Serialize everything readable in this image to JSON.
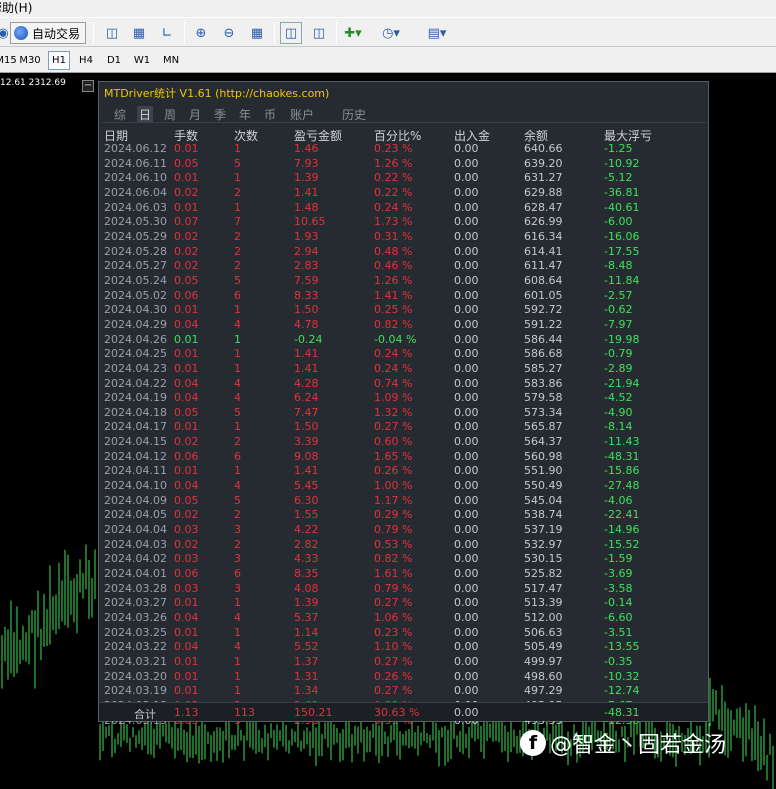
{
  "menubar": {
    "help_label": "帮助(H)"
  },
  "toolbar": {
    "autotrade_label": "自动交易"
  },
  "timeframes": [
    "M15",
    "M30",
    "H1",
    "H4",
    "D1",
    "W1",
    "MN"
  ],
  "timeframe_active": "H1",
  "chart": {
    "price_label": "12.61 2312.69"
  },
  "panel": {
    "title": "MTDriver统计 V1.61  (http://chaokes.com)",
    "tabs": [
      "综",
      "日",
      "周",
      "月",
      "季",
      "年",
      "币",
      "账户",
      "历史"
    ],
    "active_tab": "日",
    "headers": [
      "日期",
      "手数",
      "次数",
      "盈亏金额",
      "百分比%",
      "出入金",
      "余额",
      "最大浮亏"
    ],
    "rows": [
      [
        "2024.06.12",
        "0.01",
        "1",
        "1.46",
        "0.23 %",
        "0.00",
        "640.66",
        "-1.25"
      ],
      [
        "2024.06.11",
        "0.05",
        "5",
        "7.93",
        "1.26 %",
        "0.00",
        "639.20",
        "-10.92"
      ],
      [
        "2024.06.10",
        "0.01",
        "1",
        "1.39",
        "0.22 %",
        "0.00",
        "631.27",
        "-5.12"
      ],
      [
        "2024.06.04",
        "0.02",
        "2",
        "1.41",
        "0.22 %",
        "0.00",
        "629.88",
        "-36.81"
      ],
      [
        "2024.06.03",
        "0.01",
        "1",
        "1.48",
        "0.24 %",
        "0.00",
        "628.47",
        "-40.61"
      ],
      [
        "2024.05.30",
        "0.07",
        "7",
        "10.65",
        "1.73 %",
        "0.00",
        "626.99",
        "-6.00"
      ],
      [
        "2024.05.29",
        "0.02",
        "2",
        "1.93",
        "0.31 %",
        "0.00",
        "616.34",
        "-16.06"
      ],
      [
        "2024.05.28",
        "0.02",
        "2",
        "2.94",
        "0.48 %",
        "0.00",
        "614.41",
        "-17.55"
      ],
      [
        "2024.05.27",
        "0.02",
        "2",
        "2.83",
        "0.46 %",
        "0.00",
        "611.47",
        "-8.48"
      ],
      [
        "2024.05.24",
        "0.05",
        "5",
        "7.59",
        "1.26 %",
        "0.00",
        "608.64",
        "-11.84"
      ],
      [
        "2024.05.02",
        "0.06",
        "6",
        "8.33",
        "1.41 %",
        "0.00",
        "601.05",
        "-2.57"
      ],
      [
        "2024.04.30",
        "0.01",
        "1",
        "1.50",
        "0.25 %",
        "0.00",
        "592.72",
        "-0.62"
      ],
      [
        "2024.04.29",
        "0.04",
        "4",
        "4.78",
        "0.82 %",
        "0.00",
        "591.22",
        "-7.97"
      ],
      [
        "2024.04.26",
        "0.01",
        "1",
        "-0.24",
        "-0.04 %",
        "0.00",
        "586.44",
        "-19.98"
      ],
      [
        "2024.04.25",
        "0.01",
        "1",
        "1.41",
        "0.24 %",
        "0.00",
        "586.68",
        "-0.79"
      ],
      [
        "2024.04.23",
        "0.01",
        "1",
        "1.41",
        "0.24 %",
        "0.00",
        "585.27",
        "-2.89"
      ],
      [
        "2024.04.22",
        "0.04",
        "4",
        "4.28",
        "0.74 %",
        "0.00",
        "583.86",
        "-21.94"
      ],
      [
        "2024.04.19",
        "0.04",
        "4",
        "6.24",
        "1.09 %",
        "0.00",
        "579.58",
        "-4.52"
      ],
      [
        "2024.04.18",
        "0.05",
        "5",
        "7.47",
        "1.32 %",
        "0.00",
        "573.34",
        "-4.90"
      ],
      [
        "2024.04.17",
        "0.01",
        "1",
        "1.50",
        "0.27 %",
        "0.00",
        "565.87",
        "-8.14"
      ],
      [
        "2024.04.15",
        "0.02",
        "2",
        "3.39",
        "0.60 %",
        "0.00",
        "564.37",
        "-11.43"
      ],
      [
        "2024.04.12",
        "0.06",
        "6",
        "9.08",
        "1.65 %",
        "0.00",
        "560.98",
        "-48.31"
      ],
      [
        "2024.04.11",
        "0.01",
        "1",
        "1.41",
        "0.26 %",
        "0.00",
        "551.90",
        "-15.86"
      ],
      [
        "2024.04.10",
        "0.04",
        "4",
        "5.45",
        "1.00 %",
        "0.00",
        "550.49",
        "-27.48"
      ],
      [
        "2024.04.09",
        "0.05",
        "5",
        "6.30",
        "1.17 %",
        "0.00",
        "545.04",
        "-4.06"
      ],
      [
        "2024.04.05",
        "0.02",
        "2",
        "1.55",
        "0.29 %",
        "0.00",
        "538.74",
        "-22.41"
      ],
      [
        "2024.04.04",
        "0.03",
        "3",
        "4.22",
        "0.79 %",
        "0.00",
        "537.19",
        "-14.96"
      ],
      [
        "2024.04.03",
        "0.02",
        "2",
        "2.82",
        "0.53 %",
        "0.00",
        "532.97",
        "-15.52"
      ],
      [
        "2024.04.02",
        "0.03",
        "3",
        "4.33",
        "0.82 %",
        "0.00",
        "530.15",
        "-1.59"
      ],
      [
        "2024.04.01",
        "0.06",
        "6",
        "8.35",
        "1.61 %",
        "0.00",
        "525.82",
        "-3.69"
      ],
      [
        "2024.03.28",
        "0.03",
        "3",
        "4.08",
        "0.79 %",
        "0.00",
        "517.47",
        "-3.58"
      ],
      [
        "2024.03.27",
        "0.01",
        "1",
        "1.39",
        "0.27 %",
        "0.00",
        "513.39",
        "-0.14"
      ],
      [
        "2024.03.26",
        "0.04",
        "4",
        "5.37",
        "1.06 %",
        "0.00",
        "512.00",
        "-6.60"
      ],
      [
        "2024.03.25",
        "0.01",
        "1",
        "1.14",
        "0.23 %",
        "0.00",
        "506.63",
        "-3.51"
      ],
      [
        "2024.03.22",
        "0.04",
        "4",
        "5.52",
        "1.10 %",
        "0.00",
        "505.49",
        "-13.55"
      ],
      [
        "2024.03.21",
        "0.01",
        "1",
        "1.37",
        "0.27 %",
        "0.00",
        "499.97",
        "-0.35"
      ],
      [
        "2024.03.20",
        "0.01",
        "1",
        "1.31",
        "0.26 %",
        "0.00",
        "498.60",
        "-10.32"
      ],
      [
        "2024.03.19",
        "0.01",
        "1",
        "1.34",
        "0.27 %",
        "0.00",
        "497.29",
        "-12.74"
      ],
      [
        "2024.03.18",
        "0.02",
        "2",
        "2.62",
        "0.53 %",
        "0.00",
        "495.95",
        "-7.67"
      ],
      [
        "2024.03.15",
        "0.05",
        "5",
        "2.98",
        "0.59 %",
        "0.00",
        "493.33",
        "-12.56"
      ]
    ],
    "negative_row_index": 13,
    "footer": [
      "合计",
      "1.13",
      "113",
      "150.21",
      "30.63 %",
      "0.00",
      "",
      "-48.31"
    ]
  },
  "watermark": {
    "text": "@智金丶固若金汤",
    "logo_char": "f"
  },
  "colors": {
    "positive": "#e2313a",
    "negative": "#3ee05a",
    "candle": "#3ee05a",
    "title": "#f0c800",
    "panel_bg": "#262b31"
  }
}
